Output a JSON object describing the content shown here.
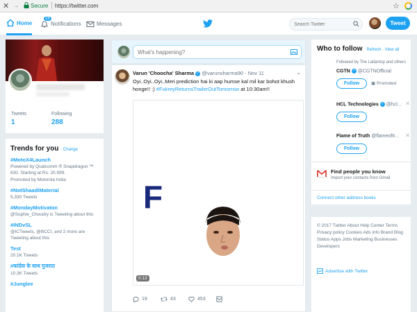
{
  "browser": {
    "secure_label": "Secure",
    "url": "https://twitter.com"
  },
  "nav": {
    "home": "Home",
    "notifications": "Notifications",
    "notifications_badge": "18",
    "messages": "Messages",
    "search_placeholder": "Search Twitter",
    "tweet_button": "Tweet"
  },
  "profile": {
    "tweets_label": "Tweets",
    "tweets_count": "1",
    "following_label": "Following",
    "following_count": "288"
  },
  "trends": {
    "title": "Trends for you",
    "change": "· Change",
    "items": [
      {
        "tag": "#MotoX4Launch",
        "desc": "Powered by Qualcomm ® Snapdragon ™ 630. Starting at Rs. 20,999.",
        "promo": "Promoted by Motorola India"
      },
      {
        "tag": "#NotShaadiMaterial",
        "desc": "5,330 Tweets"
      },
      {
        "tag": "#MondayMotivaton",
        "desc": "@Sophie_Choudry is Tweeting about this"
      },
      {
        "tag": "#INDvSL",
        "desc": "@ICTweets, @BCCI, and 2 more are Tweeting about this"
      },
      {
        "tag": "Test",
        "desc": "20.1K Tweets"
      },
      {
        "tag": "#कांग्रेस के साथ गुजरात",
        "desc": "10.3K Tweets"
      },
      {
        "tag": "#Junglee",
        "desc": ""
      }
    ]
  },
  "compose": {
    "placeholder": "What's happening?"
  },
  "tweet": {
    "name": "Varun 'Choocha' Sharma",
    "handle": "@varunsharma90 · Nov 11",
    "text": "Oyi..Oyi..Oyi..Meri prediction hai ki aap humse kal mil kar bohot khush honge!! :) ",
    "hashtag": "#FukreyReturnsTrailerOutTomorrow",
    "text_end": " at 10:30am!!",
    "media_letter": "F",
    "duration": "0:13",
    "replies": "19",
    "retweets": "43",
    "likes": "453"
  },
  "who_to_follow": {
    "title": "Who to follow",
    "links": "· Refresh · View all",
    "followed_by": "Followed by The Lallantop and others",
    "suggestions": [
      {
        "name": "CGTN",
        "handle": "@CGTNOfficial",
        "button": "Follow",
        "promoted": "Promoted"
      },
      {
        "name": "HCL Technologies",
        "handle": "@hcl...",
        "button": "Follow"
      },
      {
        "name": "Flame of Truth",
        "handle": "@flameoftr...",
        "button": "Follow"
      }
    ],
    "find_people_title": "Find people you know",
    "find_people_desc": "Import your contacts from Gmail",
    "connect_other": "Connect other address books"
  },
  "footer": {
    "links": "© 2017 Twitter  About  Help Center  Terms  Privacy policy  Cookies  Ads info  Brand  Blog  Status  Apps  Jobs  Marketing  Businesses  Developers",
    "advertise": "Advertise with Twitter"
  }
}
